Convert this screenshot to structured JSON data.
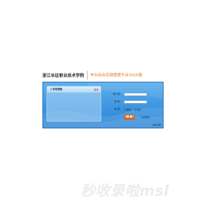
{
  "header": {
    "school_name": "浙江长征职业技术学院",
    "platform_name": "毕业综合实践管理平台2025届"
  },
  "notice": {
    "title": "【 学校通知",
    "more": "更多"
  },
  "login_form": {
    "username_label": "用户名：",
    "password_label": "密  码：",
    "role_label": "类  型：",
    "role_options": [
      "教师",
      "学生"
    ],
    "selected_role": "学生",
    "login_button": "登 录",
    "forgot_link": "忘记密码",
    "footer_link": "操作手册"
  },
  "watermark": {
    "text": "秒收录啦msl"
  },
  "colors": {
    "panel_blue": "#3d95e0",
    "platform_orange": "#e07a1a",
    "login_button": "#f07924"
  }
}
